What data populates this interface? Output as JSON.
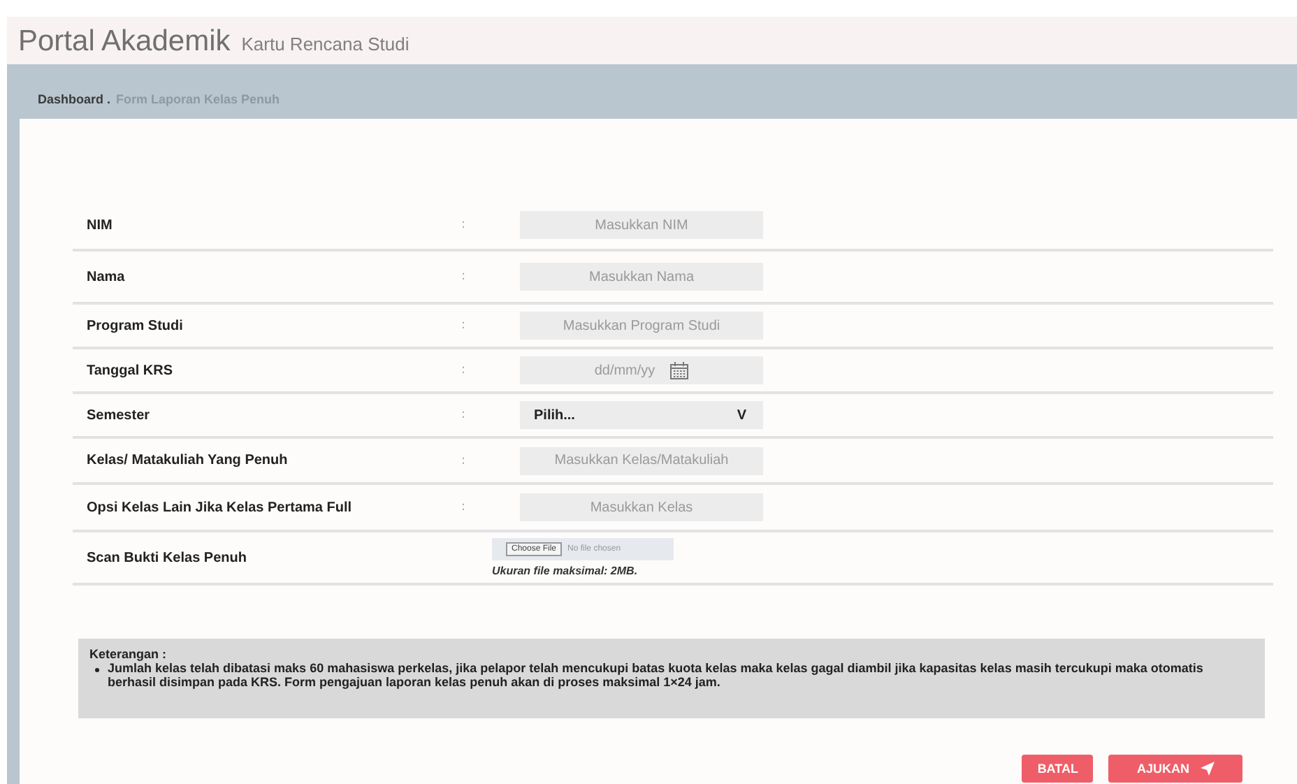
{
  "header": {
    "title": "Portal Akademik",
    "subtitle": "Kartu Rencana Studi"
  },
  "breadcrumb": {
    "home": "Dashboard .",
    "current": "Form Laporan Kelas Penuh"
  },
  "form": {
    "fields": [
      {
        "kind": "text",
        "label": "NIM",
        "separator": ":",
        "placeholder": "Masukkan NIM"
      },
      {
        "kind": "text",
        "label": "Nama",
        "separator": ":",
        "placeholder": "Masukkan Nama"
      },
      {
        "kind": "text",
        "label": "Program Studi",
        "separator": ":",
        "placeholder": "Masukkan Program Studi"
      },
      {
        "kind": "date",
        "label": "Tanggal KRS",
        "separator": ":",
        "placeholder": "dd/mm/yy"
      },
      {
        "kind": "select",
        "label": "Semester",
        "separator": ":",
        "value": "Pilih...",
        "caret": "V"
      },
      {
        "kind": "text",
        "label": "Kelas/ Matakuliah Yang Penuh",
        "separator": ":",
        "placeholder": "Masukkan Kelas/Matakuliah"
      },
      {
        "kind": "text",
        "label": "Opsi Kelas Lain Jika Kelas Pertama Full",
        "separator": ":",
        "placeholder": "Masukkan Kelas"
      },
      {
        "kind": "file",
        "label": "Scan Bukti Kelas Penuh",
        "button": "Choose File",
        "status": "No file chosen",
        "hint": "Ukuran file maksimal: 2MB."
      }
    ]
  },
  "note": {
    "title": "Keterangan :",
    "items": [
      "Jumlah kelas telah dibatasi maks 60 mahasiswa perkelas, jika pelapor telah mencukupi batas kuota kelas maka kelas gagal diambil jika kapasitas kelas masih tercukupi maka otomatis berhasil disimpan pada KRS. Form pengajuan laporan kelas penuh akan di proses maksimal 1×24 jam."
    ]
  },
  "buttons": [
    {
      "kind": "cancel",
      "label": "BATAL"
    },
    {
      "kind": "submit",
      "label": "AJUKAN"
    }
  ]
}
